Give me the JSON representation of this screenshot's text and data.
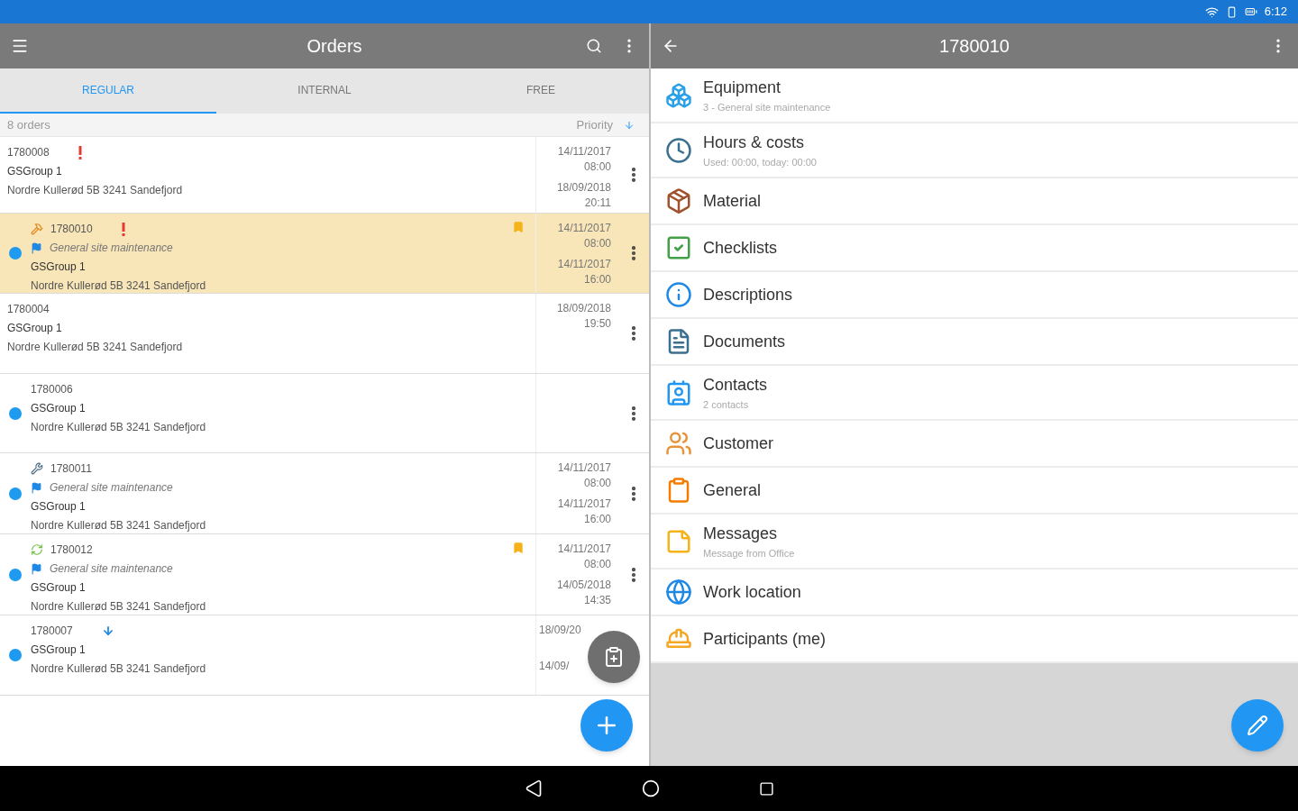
{
  "status_bar": {
    "time": "6:12"
  },
  "orders_pane": {
    "title": "Orders",
    "tabs": [
      {
        "label": "REGULAR",
        "selected": true
      },
      {
        "label": "INTERNAL",
        "selected": false
      },
      {
        "label": "FREE",
        "selected": false
      }
    ],
    "count": "8 orders",
    "sort": "Priority",
    "rows": [
      {
        "number": "1780008",
        "selected": false,
        "unread": false,
        "high_priority": true,
        "low_priority": false,
        "note": false,
        "company": "GSGroup 1",
        "address": "Nordre Kullerød 5B 3241 Sandefjord",
        "dates": [
          {
            "date": "14/11/2017",
            "time": "08:00"
          },
          {
            "date": "18/09/2018",
            "time": "20:11"
          }
        ],
        "menu": true
      },
      {
        "number": "1780010",
        "selected": true,
        "unread": true,
        "task_icon": {
          "kind": "hammer"
        },
        "high_priority": true,
        "low_priority": false,
        "note": true,
        "category": "General site maintenance",
        "company": "GSGroup 1",
        "address": "Nordre Kullerød 5B 3241 Sandefjord",
        "dates": [
          {
            "date": "14/11/2017",
            "time": "08:00"
          },
          {
            "date": "14/11/2017",
            "time": "16:00"
          }
        ],
        "menu": true
      },
      {
        "number": "1780004",
        "selected": false,
        "unread": false,
        "high_priority": false,
        "low_priority": false,
        "note": false,
        "company": "GSGroup 1",
        "address": "Nordre Kullerød 5B 3241 Sandefjord",
        "dates": [
          {
            "date": "18/09/2018",
            "time": "19:50"
          }
        ],
        "menu": true
      },
      {
        "number": "1780006",
        "selected": false,
        "unread": true,
        "high_priority": false,
        "low_priority": false,
        "note": false,
        "company": "GSGroup 1",
        "address": "Nordre Kullerød 5B 3241 Sandefjord",
        "menu": true
      },
      {
        "number": "1780011",
        "selected": false,
        "unread": true,
        "task_icon": {
          "kind": "wrench"
        },
        "high_priority": false,
        "low_priority": false,
        "note": false,
        "category": "General site maintenance",
        "company": "GSGroup 1",
        "address": "Nordre Kullerød 5B 3241 Sandefjord",
        "dates": [
          {
            "date": "14/11/2017",
            "time": "08:00"
          },
          {
            "date": "14/11/2017",
            "time": "16:00"
          }
        ],
        "menu": true
      },
      {
        "number": "1780012",
        "selected": false,
        "unread": true,
        "task_icon": {
          "kind": "recycle"
        },
        "high_priority": false,
        "low_priority": false,
        "note": true,
        "category": "General site maintenance",
        "company": "GSGroup 1",
        "address": "Nordre Kullerød 5B 3241 Sandefjord",
        "dates": [
          {
            "date": "14/11/2017",
            "time": "08:00"
          },
          {
            "date": "14/05/2018",
            "time": "14:35"
          }
        ],
        "menu": true
      },
      {
        "number": "1780007",
        "selected": false,
        "unread": true,
        "high_priority": false,
        "low_priority": true,
        "note": false,
        "company": "GSGroup 1",
        "address": "Nordre Kullerød 5B 3241 Sandefjord",
        "dates": [
          {
            "date": "18/09/20"
          },
          {
            "date": "14/09/"
          }
        ],
        "menu": false
      }
    ]
  },
  "detail_pane": {
    "title": "1780010",
    "items": [
      {
        "kind": "equipment",
        "title": "Equipment",
        "subtitle": "3 - General site maintenance"
      },
      {
        "kind": "hours",
        "title": "Hours & costs",
        "subtitle": "Used: 00:00, today: 00:00"
      },
      {
        "kind": "material",
        "title": "Material"
      },
      {
        "kind": "checklists",
        "title": "Checklists"
      },
      {
        "kind": "descriptions",
        "title": "Descriptions"
      },
      {
        "kind": "documents",
        "title": "Documents"
      },
      {
        "kind": "contacts",
        "title": "Contacts",
        "subtitle": "2 contacts"
      },
      {
        "kind": "customer",
        "title": "Customer"
      },
      {
        "kind": "general",
        "title": "General"
      },
      {
        "kind": "messages",
        "title": "Messages",
        "subtitle": "Message from Office"
      },
      {
        "kind": "location",
        "title": "Work location"
      },
      {
        "kind": "participants",
        "title": "Participants (me)"
      }
    ]
  }
}
